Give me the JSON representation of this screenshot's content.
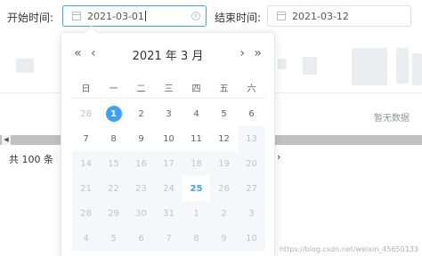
{
  "filter": {
    "start_label": "开始时间:",
    "start_value": "2021-03-01",
    "end_label": "结束时间:",
    "end_value": "2021-03-12"
  },
  "picker": {
    "prev_year": "«",
    "prev_month": "‹",
    "title": "2021 年  3 月",
    "next_month": "›",
    "next_year": "»",
    "weekdays": [
      "日",
      "一",
      "二",
      "三",
      "四",
      "五",
      "六"
    ],
    "weeks": [
      [
        {
          "d": "28",
          "s": "muted"
        },
        {
          "d": "1",
          "s": "selected"
        },
        {
          "d": "2"
        },
        {
          "d": "3"
        },
        {
          "d": "4"
        },
        {
          "d": "5"
        },
        {
          "d": "6"
        }
      ],
      [
        {
          "d": "7"
        },
        {
          "d": "8"
        },
        {
          "d": "9"
        },
        {
          "d": "10"
        },
        {
          "d": "11"
        },
        {
          "d": "12"
        },
        {
          "d": "13",
          "s": "disabled"
        }
      ],
      [
        {
          "d": "14",
          "s": "disabled"
        },
        {
          "d": "15",
          "s": "disabled"
        },
        {
          "d": "16",
          "s": "disabled"
        },
        {
          "d": "17",
          "s": "disabled"
        },
        {
          "d": "18",
          "s": "disabled"
        },
        {
          "d": "19",
          "s": "disabled"
        },
        {
          "d": "20",
          "s": "disabled"
        }
      ],
      [
        {
          "d": "21",
          "s": "disabled"
        },
        {
          "d": "22",
          "s": "disabled"
        },
        {
          "d": "23",
          "s": "disabled"
        },
        {
          "d": "24",
          "s": "disabled"
        },
        {
          "d": "25",
          "s": "today"
        },
        {
          "d": "26",
          "s": "disabled"
        },
        {
          "d": "27",
          "s": "disabled"
        }
      ],
      [
        {
          "d": "28",
          "s": "disabled"
        },
        {
          "d": "29",
          "s": "disabled"
        },
        {
          "d": "30",
          "s": "disabled"
        },
        {
          "d": "31",
          "s": "disabled"
        },
        {
          "d": "1",
          "s": "disabled"
        },
        {
          "d": "2",
          "s": "disabled"
        },
        {
          "d": "3",
          "s": "disabled"
        }
      ],
      [
        {
          "d": "4",
          "s": "disabled"
        },
        {
          "d": "5",
          "s": "disabled"
        },
        {
          "d": "6",
          "s": "disabled"
        },
        {
          "d": "7",
          "s": "disabled"
        },
        {
          "d": "8",
          "s": "disabled"
        },
        {
          "d": "9",
          "s": "disabled"
        },
        {
          "d": "10",
          "s": "disabled"
        }
      ]
    ]
  },
  "table": {
    "empty_text": "暂无数据",
    "total_text": "共 100 条",
    "next_page": "›"
  },
  "watermark": "https://blog.csdn.net/weixin_45650133",
  "colors": {
    "accent": "#409eff",
    "disabled_bg": "#f5f7fa"
  }
}
